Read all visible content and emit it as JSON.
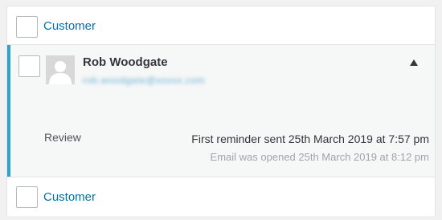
{
  "rows": [
    {
      "label": "Customer"
    },
    {
      "name": "Rob Woodgate",
      "email_obscured": "rob.woodgate@xxxxx.com",
      "review_label": "Review",
      "reminder_text": "First reminder sent 25th March 2019 at 7:57 pm",
      "opened_text": "Email was opened 25th March 2019 at 8:12 pm",
      "toggle_icon": "triangle-up-icon"
    },
    {
      "label": "Customer"
    }
  ],
  "colors": {
    "link": "#0073aa",
    "accent_border": "#2ea2cc",
    "muted_text": "#a0a5aa"
  }
}
